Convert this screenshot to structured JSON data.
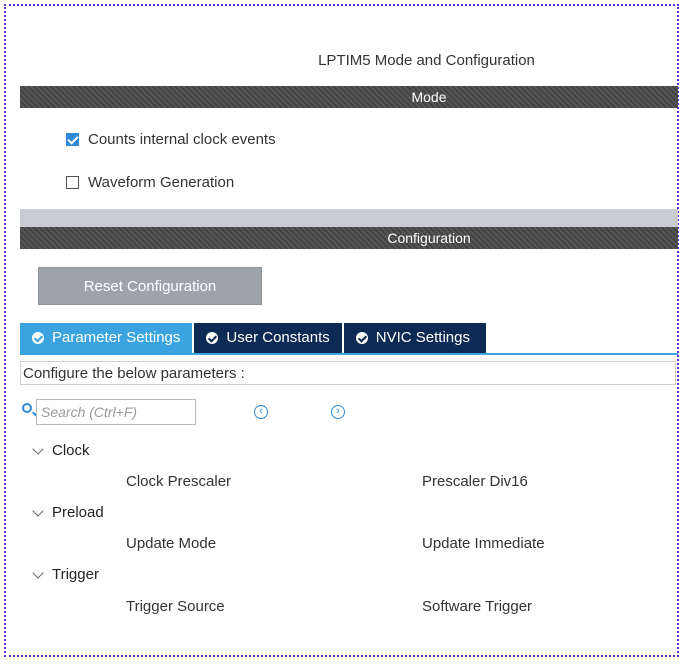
{
  "window": {
    "title": "LPTIM5 Mode and Configuration"
  },
  "mode": {
    "header": "Mode",
    "options": [
      {
        "label": "Counts internal clock events",
        "checked": true
      },
      {
        "label": "Waveform Generation",
        "checked": false
      }
    ]
  },
  "configuration": {
    "header": "Configuration",
    "reset_label": "Reset Configuration",
    "tabs": [
      {
        "label": "Parameter Settings",
        "active": true
      },
      {
        "label": "User Constants",
        "active": false
      },
      {
        "label": "NVIC Settings",
        "active": false
      }
    ],
    "instructions": "Configure the below parameters :",
    "search": {
      "placeholder": "Search (Ctrl+F)"
    },
    "groups": [
      {
        "name": "Clock",
        "params": [
          {
            "name": "Clock Prescaler",
            "value": "Prescaler Div16"
          }
        ]
      },
      {
        "name": "Preload",
        "params": [
          {
            "name": "Update Mode",
            "value": "Update Immediate"
          }
        ]
      },
      {
        "name": "Trigger",
        "params": [
          {
            "name": "Trigger Source",
            "value": "Software Trigger"
          }
        ]
      }
    ]
  },
  "colors": {
    "accent": "#3aa3e0",
    "tab_inactive": "#0d2a55",
    "header_bar": "#4a4a4a",
    "frame_border": "#5b2bd0"
  },
  "icons": [
    "check-circle-icon",
    "search-icon",
    "arrow-left-circle-icon",
    "arrow-right-circle-icon",
    "chevron-down-icon"
  ]
}
